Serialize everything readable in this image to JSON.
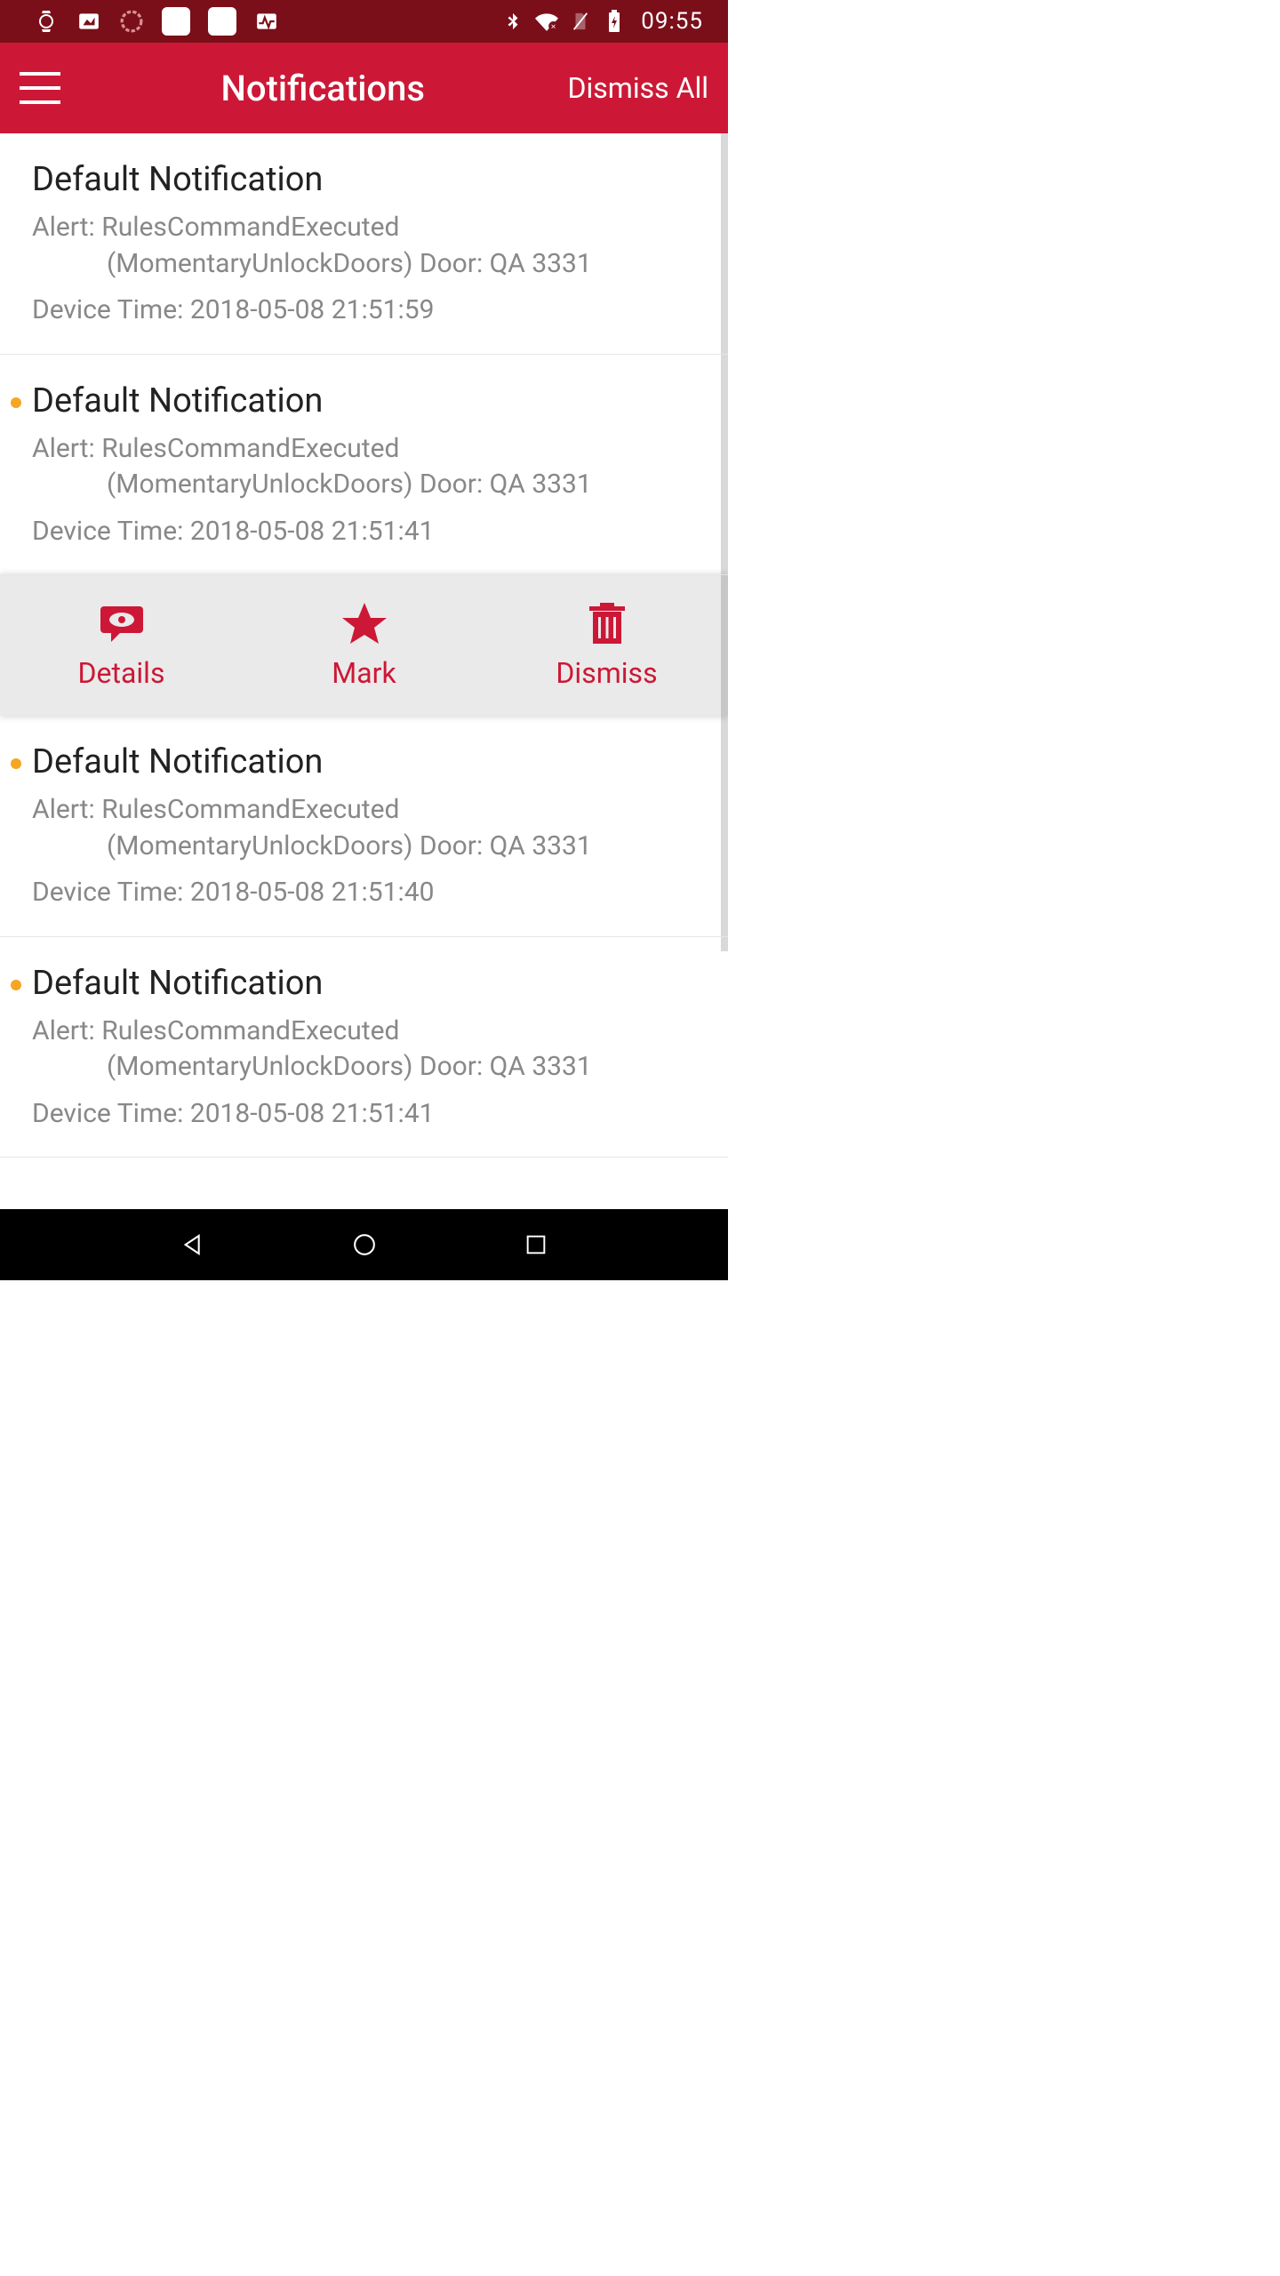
{
  "statusbar": {
    "time": "09:55",
    "icons": {
      "watch": "watch-icon",
      "image": "image-icon",
      "loading": "loading-icon",
      "app1": "app1-icon",
      "app2": "app2-icon",
      "activity": "activity-icon",
      "bluetooth": "bluetooth-icon",
      "wifi": "wifi-off-icon",
      "nosim": "no-sim-icon",
      "battery": "battery-charging-icon"
    }
  },
  "appbar": {
    "title": "Notifications",
    "dismiss_all_label": "Dismiss All"
  },
  "notifications": [
    {
      "has_dot": false,
      "title": "Default Notification",
      "alert_prefix": "Alert: ",
      "alert_body1": "RulesCommandExecuted",
      "alert_body2": "(MomentaryUnlockDoors) Door: QA 3331",
      "time_prefix": "Device Time: ",
      "time_value": "2018-05-08 21:51:59",
      "expanded": false
    },
    {
      "has_dot": true,
      "title": "Default Notification",
      "alert_prefix": "Alert: ",
      "alert_body1": "RulesCommandExecuted",
      "alert_body2": "(MomentaryUnlockDoors) Door: QA 3331",
      "time_prefix": "Device Time: ",
      "time_value": "2018-05-08 21:51:41",
      "expanded": true
    },
    {
      "has_dot": true,
      "title": "Default Notification",
      "alert_prefix": "Alert: ",
      "alert_body1": "RulesCommandExecuted",
      "alert_body2": "(MomentaryUnlockDoors) Door: QA 3331",
      "time_prefix": "Device Time: ",
      "time_value": "2018-05-08 21:51:40",
      "expanded": false
    },
    {
      "has_dot": true,
      "title": "Default Notification",
      "alert_prefix": "Alert: ",
      "alert_body1": "RulesCommandExecuted",
      "alert_body2": "(MomentaryUnlockDoors) Door: QA 3331",
      "time_prefix": "Device Time: ",
      "time_value": "2018-05-08 21:51:41",
      "expanded": false
    }
  ],
  "actions": {
    "details_label": "Details",
    "mark_label": "Mark",
    "dismiss_label": "Dismiss"
  },
  "colors": {
    "statusbar_bg": "#7a0f1a",
    "appbar_bg": "#cc1836",
    "accent": "#cc1836",
    "dot": "#f5a623",
    "text_primary": "#222222",
    "text_secondary": "#888888"
  }
}
